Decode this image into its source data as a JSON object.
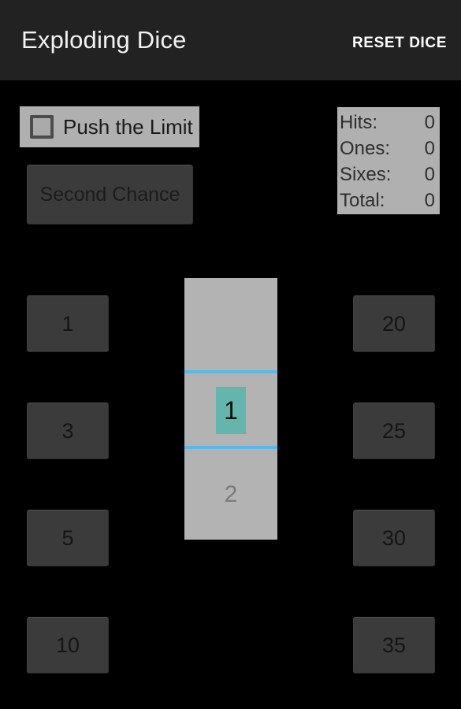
{
  "app_bar": {
    "title": "Exploding Dice",
    "reset_label": "RESET DICE",
    "background": "#222222",
    "title_color": "#f2f2f2"
  },
  "options": {
    "push_limit": {
      "label": "Push the Limit",
      "checked": false,
      "panel_color": "#b0b0b0"
    },
    "second_chance": {
      "label": "Second Chance",
      "background": "#3b3b3b"
    }
  },
  "stats": {
    "panel_color": "#b0b0b0",
    "rows": [
      {
        "label": "Hits:",
        "value": "0"
      },
      {
        "label": "Ones:",
        "value": "0"
      },
      {
        "label": "Sixes:",
        "value": "0"
      },
      {
        "label": "Total:",
        "value": "0"
      }
    ]
  },
  "number_picker": {
    "background": "#b3b3b3",
    "divider_color": "#5bb8e8",
    "highlight_color": "#64b6ac",
    "previous_value": "",
    "selected_value": "1",
    "next_value": "2"
  },
  "dice_buttons": {
    "background": "#3b3b3b",
    "left_column": [
      {
        "label": "1"
      },
      {
        "label": "3"
      },
      {
        "label": "5"
      },
      {
        "label": "10"
      }
    ],
    "right_column": [
      {
        "label": "20"
      },
      {
        "label": "25"
      },
      {
        "label": "30"
      },
      {
        "label": "35"
      }
    ]
  },
  "background": "#000000"
}
